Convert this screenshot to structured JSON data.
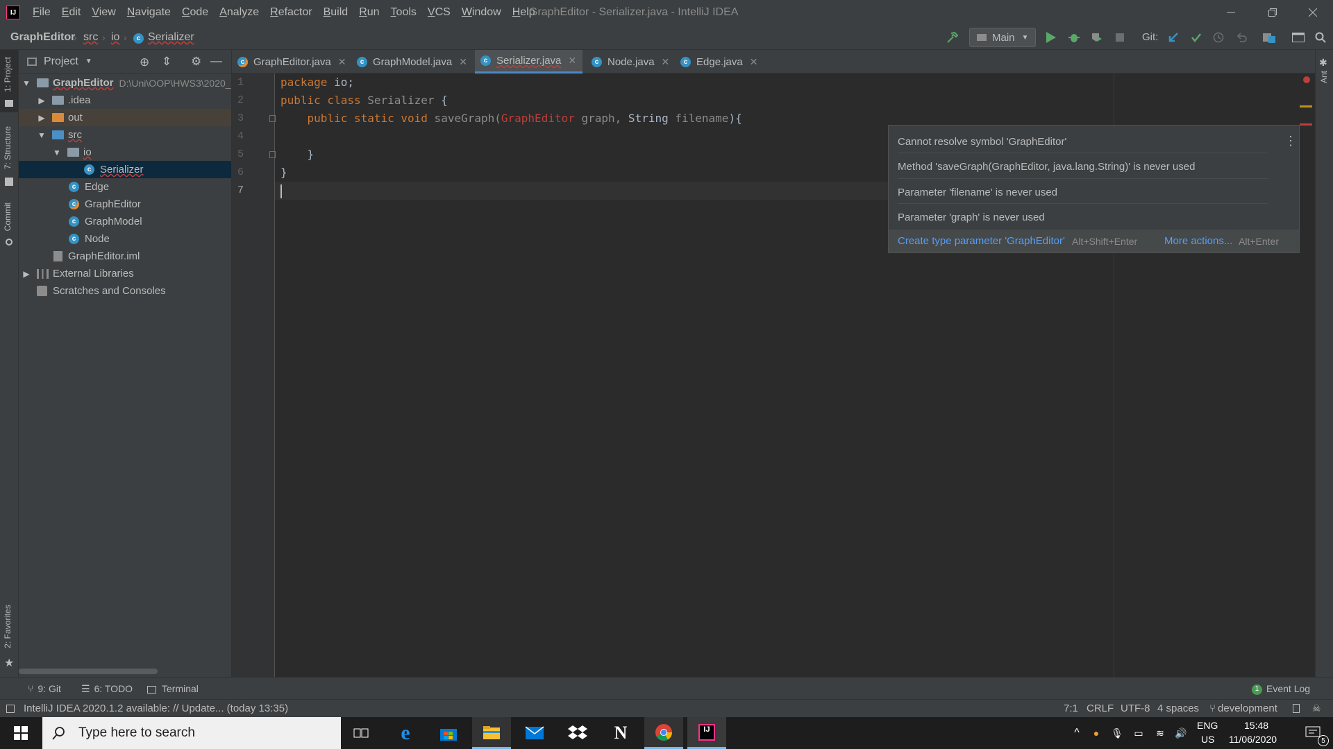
{
  "window": {
    "title": "GraphEditor - Serializer.java - IntelliJ IDEA",
    "logo": "IJ"
  },
  "menu": [
    "File",
    "Edit",
    "View",
    "Navigate",
    "Code",
    "Analyze",
    "Refactor",
    "Build",
    "Run",
    "Tools",
    "VCS",
    "Window",
    "Help"
  ],
  "breadcrumb": {
    "project": "GraphEditor",
    "src": "src",
    "io": "io",
    "file": "Serializer"
  },
  "toolbar": {
    "run_config": "Main",
    "git_label": "Git:"
  },
  "project_panel": {
    "title": "Project",
    "items": [
      {
        "label": "GraphEditor",
        "path": "D:\\Uni\\OOP\\HWS3\\2020_"
      },
      {
        "label": ".idea"
      },
      {
        "label": "out"
      },
      {
        "label": "src"
      },
      {
        "label": "io"
      },
      {
        "label": "Serializer"
      },
      {
        "label": "Edge"
      },
      {
        "label": "GraphEditor"
      },
      {
        "label": "GraphModel"
      },
      {
        "label": "Node"
      },
      {
        "label": "GraphEditor.iml"
      },
      {
        "label": "External Libraries"
      },
      {
        "label": "Scratches and Consoles"
      }
    ]
  },
  "left_tabs": {
    "project": "1: Project",
    "structure": "7: Structure",
    "commit": "Commit",
    "favorites": "2: Favorites"
  },
  "right_tabs": {
    "ant": "Ant"
  },
  "tabs": [
    {
      "label": "GraphEditor.java"
    },
    {
      "label": "GraphModel.java"
    },
    {
      "label": "Serializer.java"
    },
    {
      "label": "Node.java"
    },
    {
      "label": "Edge.java"
    }
  ],
  "code": {
    "line_numbers": [
      "1",
      "2",
      "3",
      "4",
      "5",
      "6",
      "7"
    ],
    "l1_kw": "package",
    "l1_rest": " io;",
    "l2_kw": "public class",
    "l2_name": " Serializer",
    "l2_rest": " {",
    "l3_indent": "    ",
    "l3_kw": "public static void",
    "l3_fn": " saveGraph(",
    "l3_type": "GraphEditor",
    "l3_p1": " graph,",
    "l3_type2": " String",
    "l3_p2": " filename",
    "l3_rest": "){",
    "l5": "    }",
    "l6": "}"
  },
  "popup": {
    "items": [
      "Cannot resolve symbol 'GraphEditor'",
      "Method 'saveGraph(GraphEditor, java.lang.String)' is never used",
      "Parameter 'filename' is never used",
      "Parameter 'graph' is never used"
    ],
    "action1": "Create type parameter 'GraphEditor'",
    "action1_shortcut": "Alt+Shift+Enter",
    "action2": "More actions...",
    "action2_shortcut": "Alt+Enter"
  },
  "bottom_tools": {
    "git": "9: Git",
    "todo": "6: TODO",
    "terminal": "Terminal",
    "event_log": "Event Log",
    "event_count": "1"
  },
  "status": {
    "message": "IntelliJ IDEA 2020.1.2 available: // Update... (today 13:35)",
    "position": "7:1",
    "line_sep": "CRLF",
    "encoding": "UTF-8",
    "indent": "4 spaces",
    "branch": "development"
  },
  "taskbar": {
    "search_placeholder": "Type here to search",
    "lang1": "ENG",
    "lang2": "US",
    "time": "15:48",
    "date": "11/06/2020",
    "notif_count": "5"
  },
  "colors": {
    "accent": "#4a88c7",
    "error": "#bc3f3c",
    "keyword": "#cc7832",
    "link": "#589df6"
  }
}
